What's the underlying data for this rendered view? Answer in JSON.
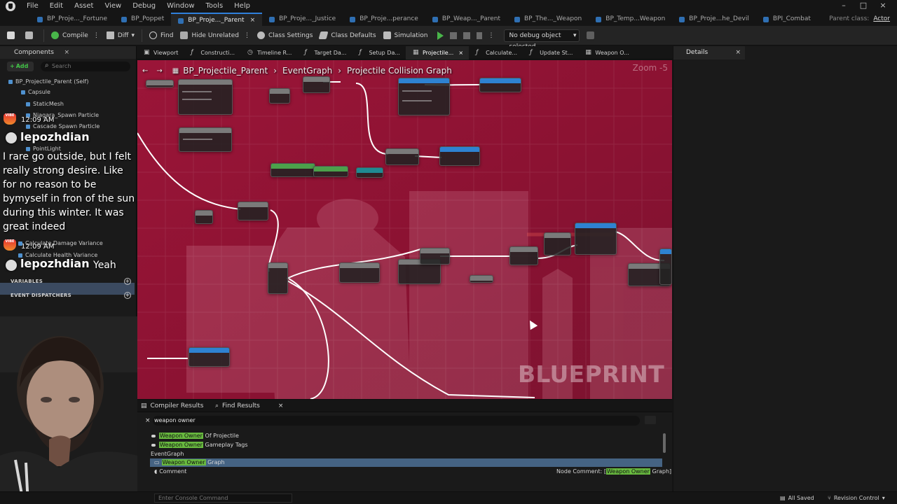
{
  "menu": [
    "File",
    "Edit",
    "Asset",
    "View",
    "Debug",
    "Window",
    "Tools",
    "Help"
  ],
  "window_controls": [
    "–",
    "□",
    "×"
  ],
  "document_tabs": [
    {
      "label": "BP_Proje..._Fortune",
      "active": false
    },
    {
      "label": "BP_Poppet",
      "active": false
    },
    {
      "label": "BP_Proje..._Parent",
      "active": true
    },
    {
      "label": "BP_Proje..._Justice",
      "active": false
    },
    {
      "label": "BP_Proje...perance",
      "active": false
    },
    {
      "label": "BP_Weap..._Parent",
      "active": false
    },
    {
      "label": "BP_The..._Weapon",
      "active": false
    },
    {
      "label": "BP_Temp...Weapon",
      "active": false
    },
    {
      "label": "BP_Proje...he_Devil",
      "active": false
    },
    {
      "label": "BPI_Combat",
      "active": false
    }
  ],
  "parent_class": {
    "label": "Parent class:",
    "value": "Actor"
  },
  "toolbar": {
    "compile": "Compile",
    "diff": "Diff",
    "find": "Find",
    "hide_unrelated": "Hide Unrelated",
    "class_settings": "Class Settings",
    "class_defaults": "Class Defaults",
    "simulation": "Simulation",
    "debug_object": "No debug object selected"
  },
  "components": {
    "title": "Components",
    "add_label": "Add",
    "search_placeholder": "Search",
    "tree": [
      "BP_Projectile_Parent (Self)",
      "Capsule",
      "StaticMesh",
      "Niagara_Spawn Particle",
      "Cascade Spawn Particle",
      "PointLight"
    ],
    "highlighted_function": "Calculate Damage Variance",
    "partial_function": "Calculate Health Variance",
    "variables_label": "VARIABLES",
    "event_dispatchers_label": "EVENT DISPATCHERS"
  },
  "chat": {
    "badge_label": "VIBE",
    "messages": [
      {
        "time": "12:09 AM",
        "user": "lepozhdian",
        "text": "I rare go outside, but I felt really strong desire. Like for no reason to be bymyself in fron of the sun during this winter. It was great indeed"
      },
      {
        "time": "12:09 AM",
        "user": "lepozhdian",
        "text": "Yeah"
      }
    ]
  },
  "graph_tabs": [
    {
      "label": "Viewport",
      "active": false
    },
    {
      "label": "Constructi...",
      "active": false
    },
    {
      "label": "Timeline R...",
      "active": false
    },
    {
      "label": "Target Da...",
      "active": false
    },
    {
      "label": "Setup Da...",
      "active": false
    },
    {
      "label": "Projectile...",
      "active": true
    },
    {
      "label": "Calculate...",
      "active": false
    },
    {
      "label": "Update St...",
      "active": false
    },
    {
      "label": "Weapon O...",
      "active": false
    }
  ],
  "graph": {
    "breadcrumbs": [
      "BP_Projectile_Parent",
      "EventGraph",
      "Projectile Collision Graph"
    ],
    "zoom": "Zoom -5",
    "watermark": "BLUEPRINT"
  },
  "details": {
    "title": "Details"
  },
  "bottom_tabs": [
    "Compiler Results",
    "Find Results"
  ],
  "find": {
    "query": "weapon owner",
    "results": [
      {
        "highlight": "Weapon Owner",
        "rest": " Of Projectile"
      },
      {
        "highlight": "Weapon Owner",
        "rest": " Gameplay Tags"
      }
    ],
    "event_graph_label": "EventGraph",
    "selected_result": {
      "highlight": "Weapon Owner",
      "rest": " Graph"
    },
    "comment_label": "Comment",
    "node_comment": {
      "prefix": "Node Comment: [",
      "highlight": "Weapon Owner",
      "suffix": " Graph]"
    }
  },
  "status": {
    "console_placeholder": "Enter Console Command",
    "saved": "All Saved",
    "revision_control": "Revision Control"
  },
  "colors": {
    "graph_background": "#8a1230",
    "selection": "#456383",
    "highlight": "#68b93f",
    "tab_accent": "#2f7fdc"
  }
}
